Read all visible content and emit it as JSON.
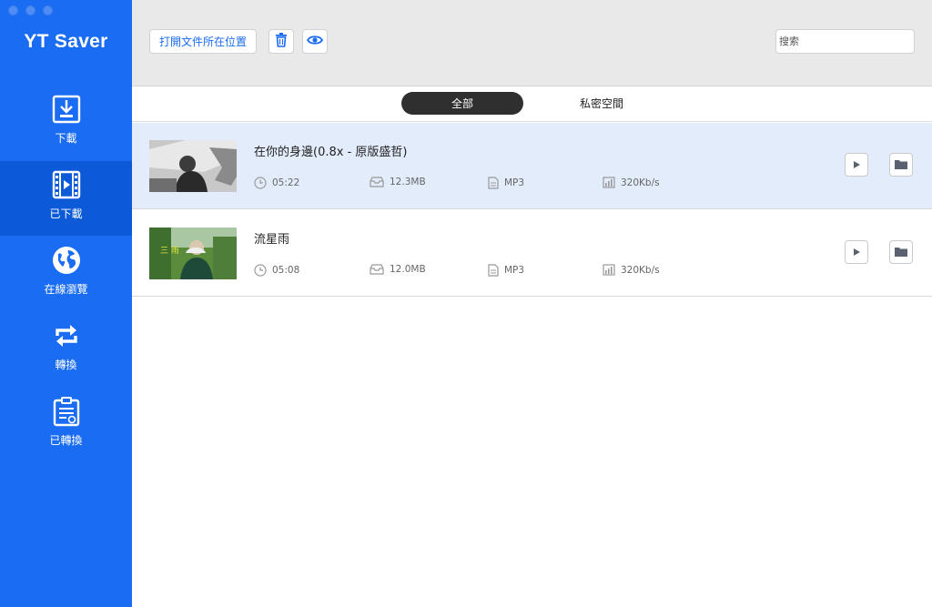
{
  "app": {
    "brand": "YT Saver"
  },
  "sidebar": {
    "items": [
      {
        "label": "下載",
        "icon": "download-icon"
      },
      {
        "label": "已下載",
        "icon": "film-icon",
        "active": true
      },
      {
        "label": "在線瀏覽",
        "icon": "globe-icon"
      },
      {
        "label": "轉換",
        "icon": "convert-icon"
      },
      {
        "label": "已轉換",
        "icon": "converted-doc-icon"
      }
    ]
  },
  "toolbar": {
    "open_folder_label": "打開文件所在位置",
    "delete_icon": "trash-icon",
    "view_icon": "eye-icon",
    "search_placeholder": "搜索"
  },
  "tabs": [
    {
      "label": "全部",
      "active": true
    },
    {
      "label": "私密空間",
      "active": false
    }
  ],
  "items": [
    {
      "title": "在你的身邊(0.8x - 原版盛哲)",
      "duration": "05:22",
      "size": "12.3MB",
      "format": "MP3",
      "bitrate": "320Kb/s",
      "selected": true
    },
    {
      "title": "流星雨",
      "duration": "05:08",
      "size": "12.0MB",
      "format": "MP3",
      "bitrate": "320Kb/s",
      "selected": false
    }
  ],
  "colors": {
    "accent": "#1a6cf2",
    "sidebar_active": "#0d5ad9",
    "row_selected": "#e3ecfb"
  }
}
